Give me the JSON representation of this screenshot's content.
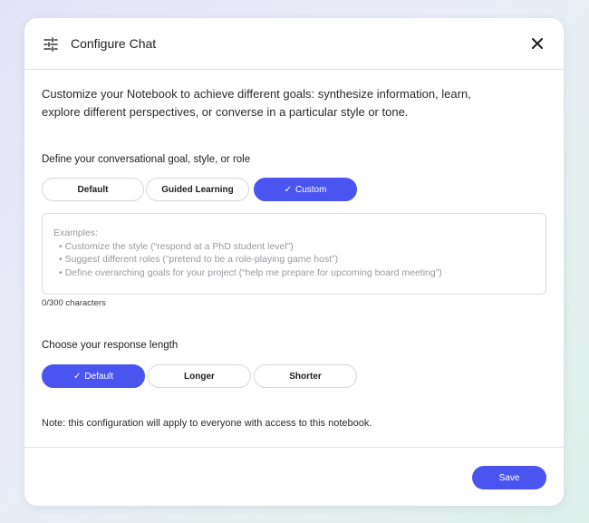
{
  "dialog": {
    "title": "Configure Chat",
    "intro": "Customize your Notebook to achieve different goals: synthesize information, learn, explore different perspectives, or converse in a particular style or tone."
  },
  "goal": {
    "label": "Define your conversational goal, style, or role",
    "options": [
      {
        "label": "Default",
        "selected": false
      },
      {
        "label": "Guided Learning",
        "selected": false
      },
      {
        "label": "Custom",
        "selected": true
      }
    ],
    "placeholder": {
      "heading": "Examples:",
      "items": [
        "•  Customize the style (“respond at a PhD student level”)",
        "•  Suggest different roles (“pretend to be a role-playing game host”)",
        "•  Define overarching goals for your project (“help me prepare for upcoming board meeting”)"
      ]
    },
    "counter": "0/300 characters"
  },
  "length": {
    "label": "Choose your response length",
    "options": [
      {
        "label": "Default",
        "selected": true
      },
      {
        "label": "Longer",
        "selected": false
      },
      {
        "label": "Shorter",
        "selected": false
      }
    ]
  },
  "note": "Note: this configuration will apply to everyone with access to this notebook.",
  "footer": {
    "save_label": "Save"
  },
  "colors": {
    "accent": "#4a55f0",
    "border": "#d8d8de",
    "placeholder": "#9a9aa0"
  },
  "icons": {
    "header": "tune-icon",
    "close": "close-icon",
    "check": "check-icon"
  }
}
